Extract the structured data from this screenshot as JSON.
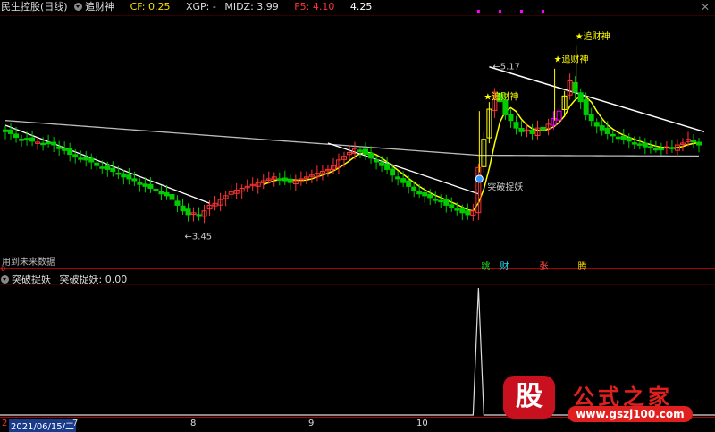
{
  "header": {
    "stock_name": "民生控股(日线)",
    "indicator_name": "追财神",
    "cf_label": "CF:",
    "cf_value": "0.25",
    "xgp_label": "XGP: -",
    "midz_label": "MIDZ:",
    "midz_value": "3.99",
    "f5_label": "F5:",
    "f5_value": "4.10",
    "last_value": "4.25",
    "close_glyph": "✕"
  },
  "sub_panel": {
    "title": "突破捉妖",
    "value_label": "突破捉妖:",
    "value": "0.00"
  },
  "main_annotations": {
    "low_price": "3.45",
    "high_price": "5.17",
    "future_data_note": "用到未来数据",
    "breakout_label": "突破捉妖",
    "zhuicaishen_1": "追财神",
    "zhuicaishen_2": "追财神",
    "zhuicaishen_3": "追财神",
    "zero_marker": "0"
  },
  "signals": [
    {
      "text": "跳",
      "color": "#22dd22"
    },
    {
      "text": "财",
      "color": "#22ddff"
    },
    {
      "text": "张",
      "color": "#ff4444"
    },
    {
      "text": "腾",
      "color": "#ffdd00"
    }
  ],
  "date_axis": {
    "first_tick": "2",
    "cursor_date": "2021/06/15/二",
    "months": [
      "7",
      "8",
      "9",
      "10"
    ]
  },
  "colors": {
    "up": "#ff3333",
    "down": "#00cc00",
    "yellow": "#ffff00",
    "white": "#ffffff",
    "magenta": "#ff00ff",
    "gray": "#bbbbbb"
  },
  "chart_data": {
    "type": "candlestick",
    "low_marker": 3.45,
    "high_marker": 5.17,
    "close": [
      4.48,
      4.46,
      4.42,
      4.4,
      4.4,
      4.38,
      4.37,
      4.35,
      4.36,
      4.34,
      4.3,
      4.28,
      4.24,
      4.22,
      4.2,
      4.18,
      4.16,
      4.12,
      4.1,
      4.08,
      4.06,
      4.04,
      4.0,
      3.98,
      3.96,
      3.92,
      3.9,
      3.88,
      3.86,
      3.82,
      3.8,
      3.76,
      3.7,
      3.64,
      3.6,
      3.62,
      3.58,
      3.64,
      3.7,
      3.72,
      3.76,
      3.8,
      3.84,
      3.86,
      3.88,
      3.9,
      3.92,
      3.94,
      3.96,
      3.98,
      4.0,
      3.98,
      3.96,
      3.94,
      3.96,
      3.98,
      4.0,
      4.02,
      4.04,
      4.06,
      4.08,
      4.12,
      4.18,
      4.22,
      4.26,
      4.3,
      4.28,
      4.24,
      4.2,
      4.16,
      4.12,
      4.08,
      4.02,
      3.98,
      3.94,
      3.9,
      3.86,
      3.82,
      3.8,
      3.78,
      3.76,
      3.74,
      3.7,
      3.68,
      3.66,
      3.62,
      3.6,
      3.64,
      4.1,
      4.4,
      4.72,
      4.9,
      4.8,
      4.66,
      4.6,
      4.52,
      4.48,
      4.5,
      4.46,
      4.52,
      4.5,
      4.56,
      4.62,
      4.7,
      4.86,
      5.02,
      4.9,
      4.8,
      4.66,
      4.6,
      4.54,
      4.5,
      4.46,
      4.44,
      4.42,
      4.4,
      4.38,
      4.36,
      4.34,
      4.32,
      4.32,
      4.3,
      4.3,
      4.32,
      4.3,
      4.34,
      4.36,
      4.4,
      4.38,
      4.34
    ]
  },
  "sub_chart_data": {
    "type": "line",
    "peak_value": 1,
    "peak_index": 88,
    "baseline": 0
  }
}
